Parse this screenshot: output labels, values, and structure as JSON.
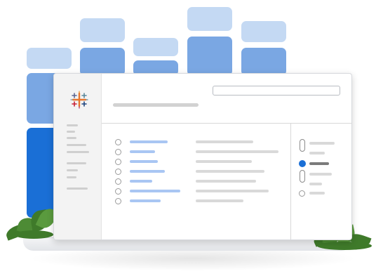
{
  "illustration": {
    "logo_icon": "tableau-cross-logo-icon",
    "colors": {
      "bar_light": "#c4d9f3",
      "bar_mid": "#7aa7e3",
      "bar_dark": "#1a6fd6",
      "link_blue": "#a9c6f3",
      "selected_blue": "#1a6fd6",
      "placeholder_gray": "#d9d9d9",
      "leaf_green": "#3f7a2a"
    },
    "list_rows": 7,
    "filter_options": 6,
    "selected_filter_index": 2
  }
}
